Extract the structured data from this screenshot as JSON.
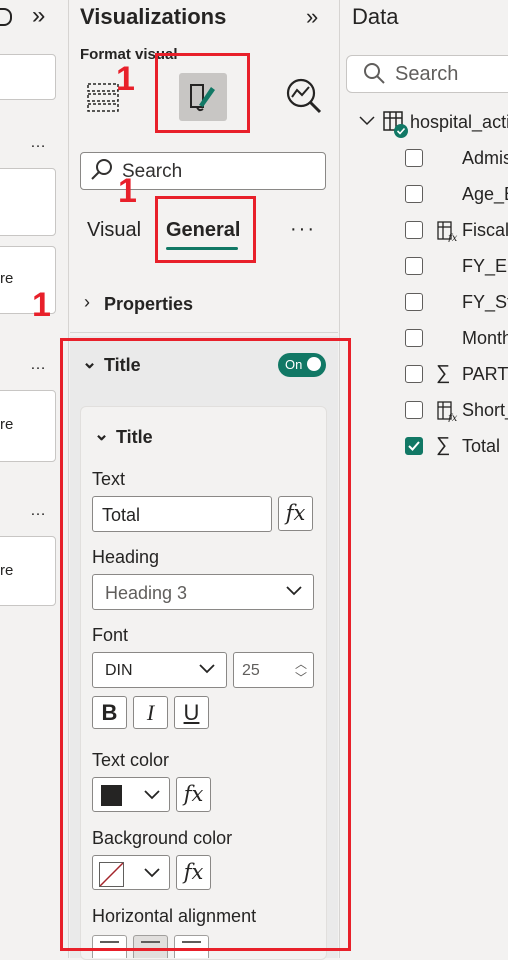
{
  "left_pane": {
    "chevron": "»",
    "cards": [
      {
        "dots": "…",
        "text": ""
      },
      {
        "dots": "",
        "text": "re"
      },
      {
        "dots": "…",
        "text": "re"
      },
      {
        "dots": "…",
        "text": "re"
      }
    ]
  },
  "viz": {
    "title": "Visualizations",
    "collapse_chevron": "»",
    "format_visual_label": "Format visual",
    "search_placeholder": "Search",
    "tabs": [
      "Visual",
      "General"
    ],
    "more": "···",
    "properties_label": "Properties",
    "title_section_label": "Title",
    "toggle_label": "On",
    "inner_title_label": "Title",
    "text_label": "Text",
    "text_value": "Total",
    "fx": "fx",
    "heading_label": "Heading",
    "heading_value": "Heading 3",
    "font_label": "Font",
    "font_value": "DIN",
    "font_size": "25",
    "bold": "B",
    "italic": "I",
    "underline": "U",
    "text_color_label": "Text color",
    "text_color": "#252423",
    "bg_color_label": "Background color",
    "halign_label": "Horizontal alignment"
  },
  "data": {
    "title": "Data",
    "search_placeholder": "Search",
    "table_name": "hospital_acti",
    "fields": [
      {
        "name": "Admis",
        "type": "text",
        "checked": false
      },
      {
        "name": "Age_B",
        "type": "text",
        "checked": false
      },
      {
        "name": "Fiscal",
        "type": "calc-column",
        "checked": false
      },
      {
        "name": "FY_En",
        "type": "text",
        "checked": false
      },
      {
        "name": "FY_Sta",
        "type": "text",
        "checked": false
      },
      {
        "name": "Month",
        "type": "text",
        "checked": false
      },
      {
        "name": "PARTY",
        "type": "sum",
        "checked": false
      },
      {
        "name": "Short_",
        "type": "calc-column",
        "checked": false
      },
      {
        "name": "Total",
        "type": "sum",
        "checked": true
      }
    ]
  },
  "annotations": [
    "1",
    "1",
    "1"
  ],
  "colors": {
    "accent": "#117865",
    "annotation_red": "#e8202a"
  }
}
